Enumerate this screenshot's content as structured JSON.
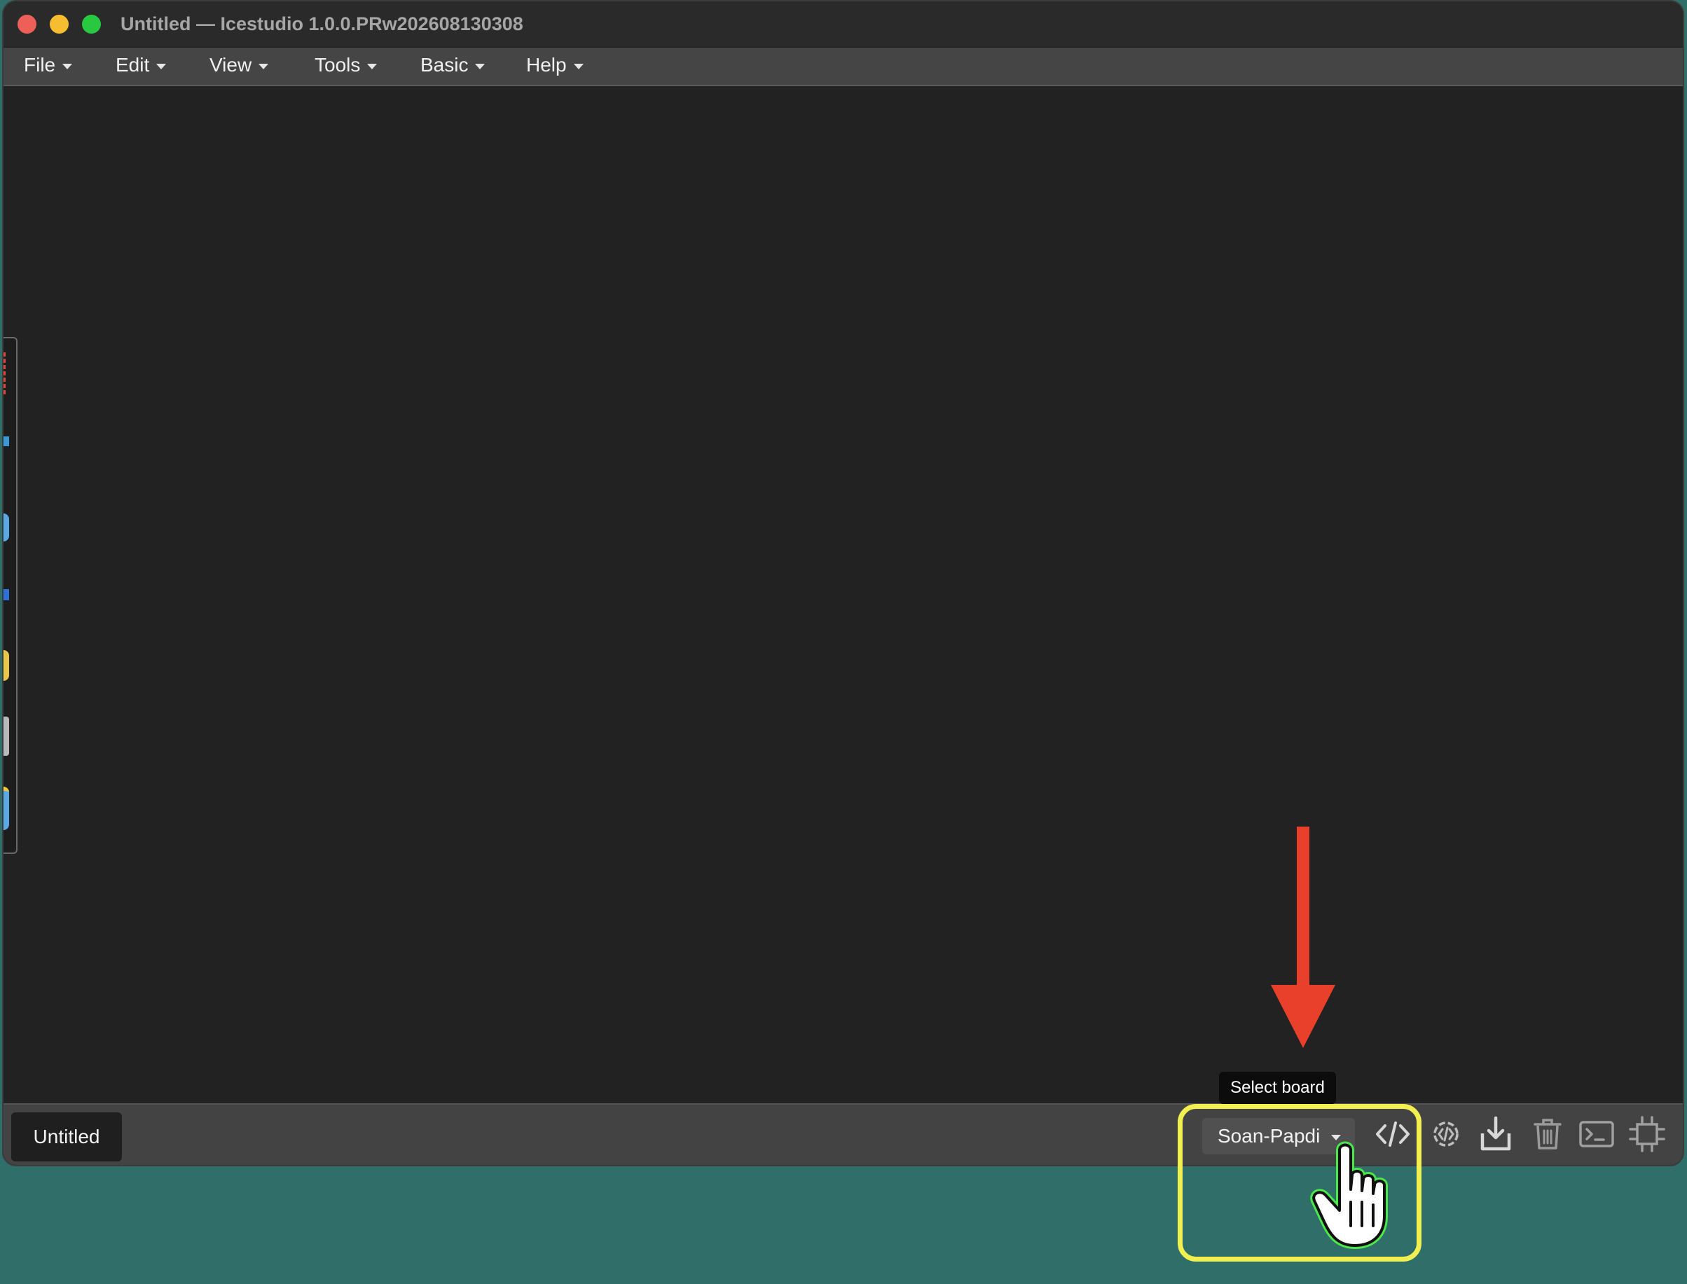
{
  "window": {
    "title": "Untitled — Icestudio 1.0.0.PRw202608130308"
  },
  "menubar": {
    "items": [
      {
        "label": "File"
      },
      {
        "label": "Edit"
      },
      {
        "label": "View"
      },
      {
        "label": "Tools"
      },
      {
        "label": "Basic"
      },
      {
        "label": "Help"
      }
    ]
  },
  "bottombar": {
    "design_tab": "Untitled",
    "board_select": {
      "selected": "Soan-Papdi"
    },
    "tools": [
      "verilog-code-icon",
      "build-icon",
      "upload-icon",
      "delete-icon",
      "terminal-icon",
      "chip-icon"
    ]
  },
  "tooltip": {
    "text": "Select board"
  },
  "colors": {
    "annotation_arrow": "#e8402a",
    "annotation_box": "#f2f051",
    "cursor_outline": "#4be84b",
    "desktop": "#2f6e69"
  }
}
